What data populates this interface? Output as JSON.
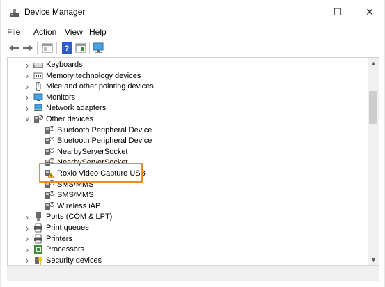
{
  "window": {
    "title": "Device Manager"
  },
  "controls": {
    "minimize": "—",
    "maximize": "☐",
    "close": "✕"
  },
  "menu": {
    "file": "File",
    "action": "Action",
    "view": "View",
    "help": "Help"
  },
  "tree": {
    "items": [
      {
        "label": "Keyboards",
        "icon": "keyboard-icon",
        "expand": "collapsed"
      },
      {
        "label": "Memory technology devices",
        "icon": "memory-icon",
        "expand": "collapsed"
      },
      {
        "label": "Mice and other pointing devices",
        "icon": "mouse-icon",
        "expand": "collapsed"
      },
      {
        "label": "Monitors",
        "icon": "monitor-icon",
        "expand": "collapsed"
      },
      {
        "label": "Network adapters",
        "icon": "network-icon",
        "expand": "collapsed"
      },
      {
        "label": "Other devices",
        "icon": "unknown-device-icon",
        "expand": "expanded"
      },
      {
        "label": "Bluetooth Peripheral Device",
        "icon": "unknown-device-icon",
        "child": true
      },
      {
        "label": "Bluetooth Peripheral Device",
        "icon": "unknown-device-icon",
        "child": true
      },
      {
        "label": "NearbyServerSocket",
        "icon": "unknown-device-icon",
        "child": true
      },
      {
        "label": "NearbyServerSocket",
        "icon": "unknown-device-icon",
        "child": true
      },
      {
        "label": "Roxio Video Capture USB",
        "icon": "warning-device-icon",
        "child": true
      },
      {
        "label": "SMS/MMS",
        "icon": "unknown-device-icon",
        "child": true
      },
      {
        "label": "SMS/MMS",
        "icon": "unknown-device-icon",
        "child": true
      },
      {
        "label": "Wireless iAP",
        "icon": "unknown-device-icon",
        "child": true
      },
      {
        "label": "Ports (COM & LPT)",
        "icon": "port-icon",
        "expand": "collapsed"
      },
      {
        "label": "Print queues",
        "icon": "printer-icon",
        "expand": "collapsed"
      },
      {
        "label": "Printers",
        "icon": "printer-icon",
        "expand": "collapsed"
      },
      {
        "label": "Processors",
        "icon": "processor-icon",
        "expand": "collapsed"
      },
      {
        "label": "Security devices",
        "icon": "security-icon",
        "expand": "collapsed"
      }
    ]
  },
  "colors": {
    "highlight": "#f08a24",
    "warning": "#f5c400"
  }
}
